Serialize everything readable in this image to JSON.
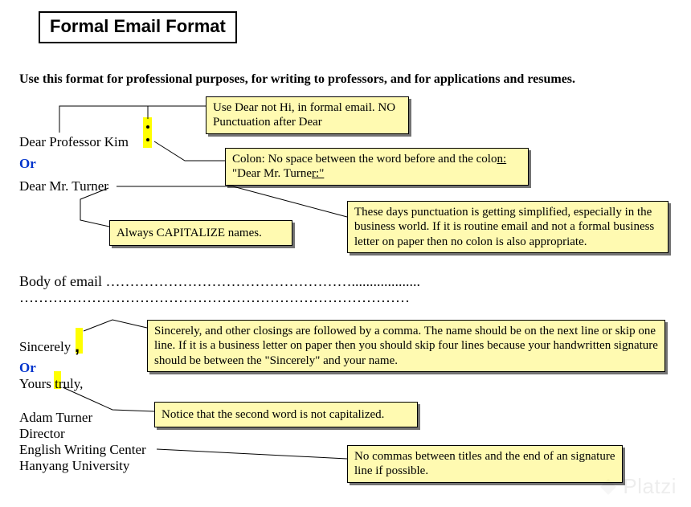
{
  "title": "Formal Email Format",
  "intro": "Use this format for professional purposes, for writing to professors, and for applications and resumes.",
  "salutation1": "Dear Professor Kim",
  "or1": "Or",
  "salutation2": "Dear Mr. Turner",
  "body1": "Body of email ……………………………………………...................",
  "body2": "………………………………………………………………………",
  "closing1": "Sincerely",
  "or2": "Or",
  "closing2": "Yours truly,",
  "sig1": "Adam Turner",
  "sig2": "Director",
  "sig3": "English Writing Center",
  "sig4": "Hanyang University",
  "callouts": {
    "dear": "Use Dear not Hi, in formal email. NO Punctuation after Dear",
    "colon_pre": "Colon: No space between the word before and the colo",
    "colon_u1": "n:",
    "colon_mid": " \"Dear Mr. Turne",
    "colon_u2": "r:\"",
    "capitalize": "Always CAPITALIZE names.",
    "simplified": "These days punctuation is getting simplified, especially in the business world. If it is routine email and not a formal business letter on paper then no colon is also appropriate.",
    "sincerely": "Sincerely, and other closings are followed by a comma. The name should be on the next line or skip one line. If it is a business letter on paper then you should skip four lines because your handwritten signature should be between the \"Sincerely\" and your name.",
    "second_word": "Notice that the second word is not capitalized.",
    "no_commas": "No commas between titles and the end of an signature line if possible."
  },
  "watermark": "Platzi"
}
